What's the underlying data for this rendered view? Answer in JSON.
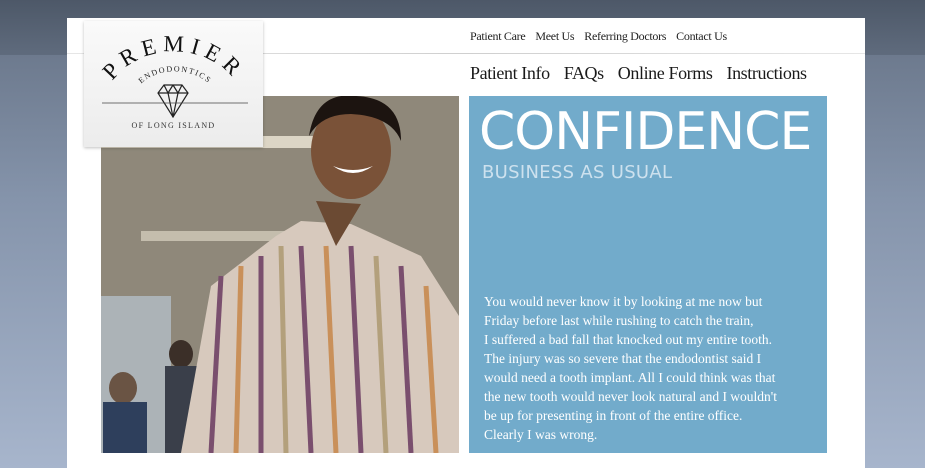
{
  "logo": {
    "word": "PREMIER",
    "subword": "ENDODONTICS",
    "tagline": "OF LONG ISLAND"
  },
  "util_nav": [
    "Patient Care",
    "Meet Us",
    "Referring Doctors",
    "Contact Us"
  ],
  "main_nav": [
    "Patient Info",
    "FAQs",
    "Online Forms",
    "Instructions"
  ],
  "hero": {
    "headline": "CONFIDENCE",
    "subheadline": "BUSINESS AS USUAL",
    "testimonial_lines": [
      "You would never know it by looking at me now but",
      "Friday before last while rushing to catch the train,",
      "I suffered a bad fall that knocked out my entire tooth.",
      "The injury was so severe that the endodontist said I",
      "would need a tooth implant. All I could think was that",
      "the new tooth would never look natural and I wouldn't",
      "be up for presenting in front of the entire office.",
      "Clearly I was wrong."
    ]
  },
  "colors": {
    "panel": "#72abcb",
    "background": "#8594ab"
  }
}
